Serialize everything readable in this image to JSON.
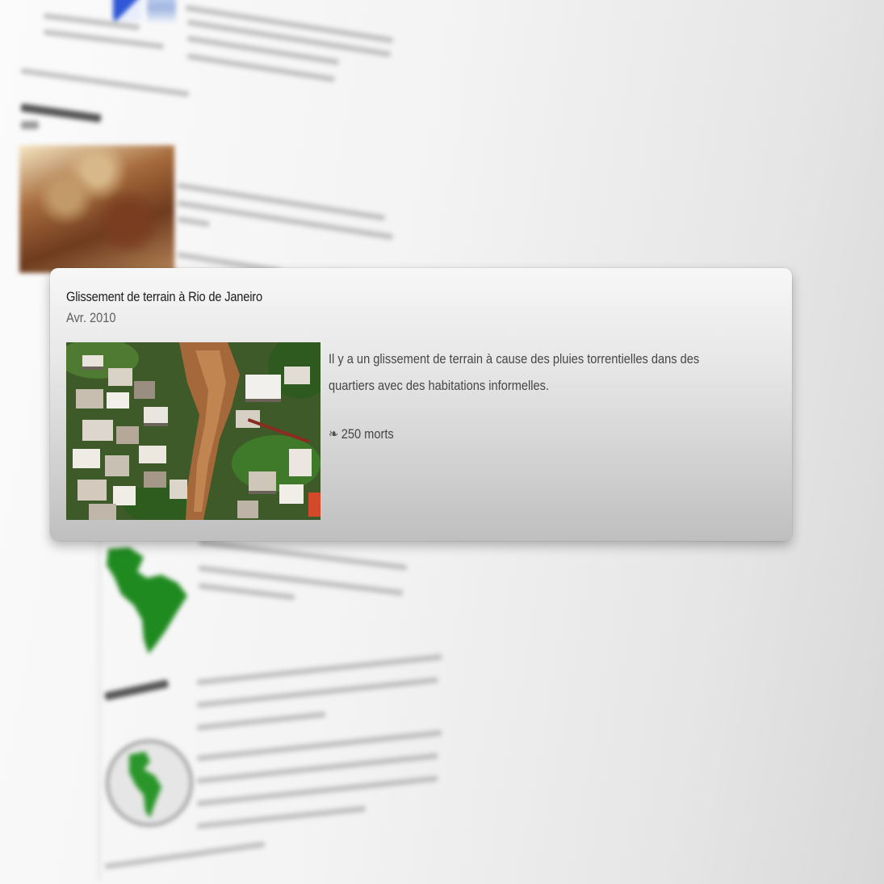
{
  "event_card": {
    "title": "Glissement de terrain à Rio de Janeiro",
    "date": "Avr. 2010",
    "description": "Il y a un glissement de terrain à cause des pluies torrentielles dans des quartiers avec des habitations informelles.",
    "deaths_icon": "❧",
    "deaths": "250 morts",
    "photo_icon": "landslide-aerial-photo"
  },
  "colors": {
    "card_top": "#f7f7f7",
    "card_bottom": "#bfbfbf",
    "title_text": "#1c1c1c",
    "body_text": "#464646",
    "map_highlight": "#1f8a1f"
  }
}
